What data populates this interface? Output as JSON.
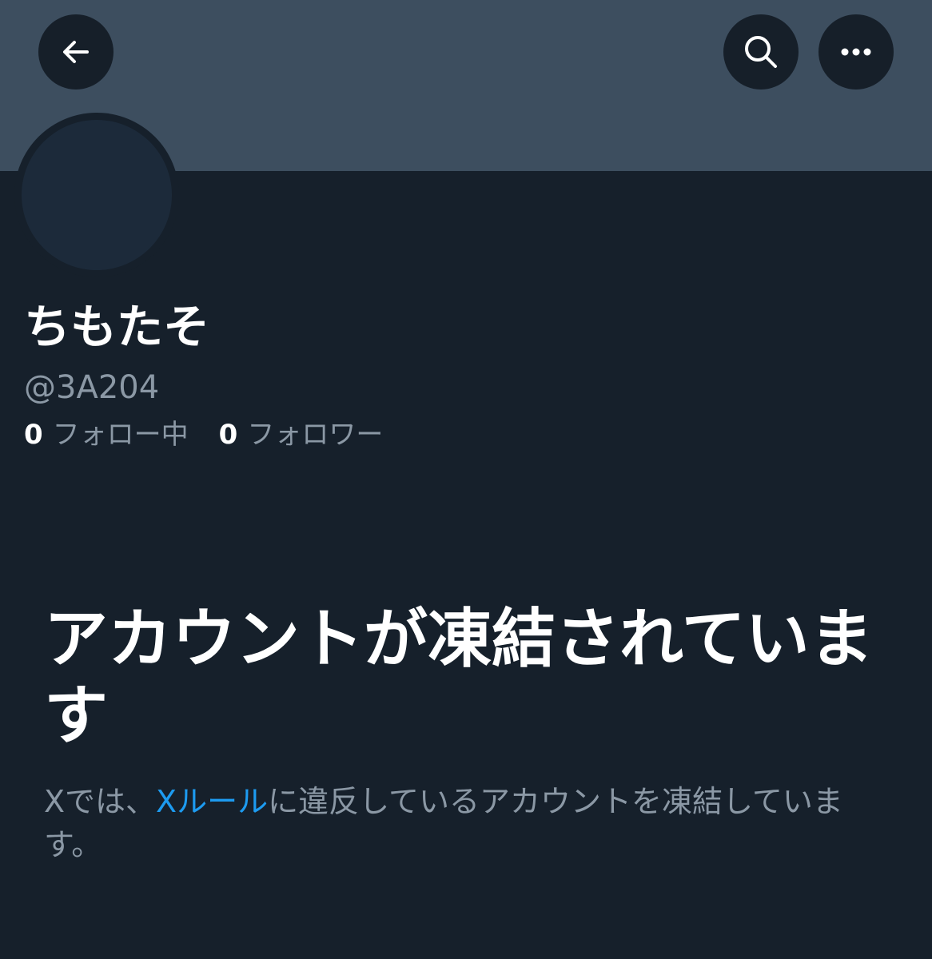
{
  "profile": {
    "display_name": "ちもたそ",
    "handle": "@3A204",
    "following_count": "0",
    "following_label": "フォロー中",
    "followers_count": "0",
    "followers_label": "フォロワー"
  },
  "header": {
    "back_icon": "arrow-left-icon",
    "search_icon": "search-icon",
    "more_icon": "more-horizontal-icon"
  },
  "suspension": {
    "title": "アカウントが凍結されています",
    "desc_before_link": "Xでは、",
    "link_text": "Xルール",
    "desc_after_link": "に違反しているアカウントを凍結しています。"
  },
  "colors": {
    "background": "#16202b",
    "banner": "#3d4e5f",
    "link": "#1d9bf0",
    "secondary_text": "#8b98a5"
  }
}
